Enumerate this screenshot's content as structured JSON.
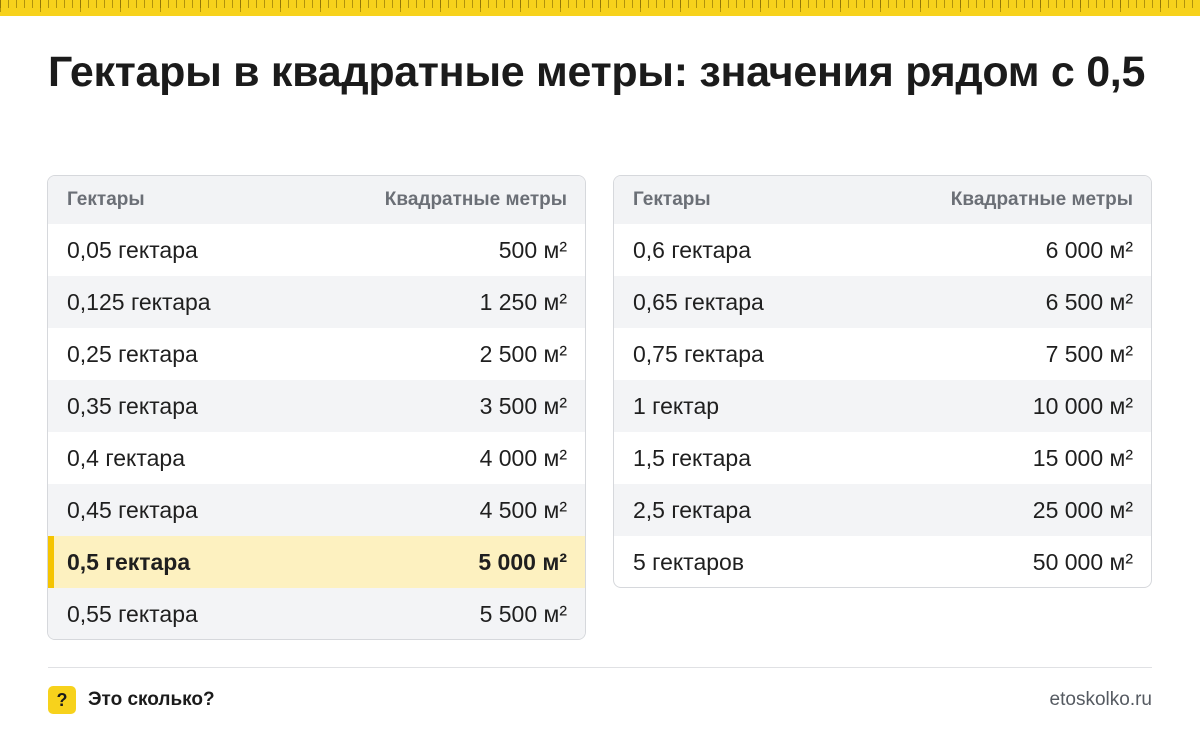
{
  "title": "Гектары в квадратные метры: значения рядом с 0,5",
  "headers": {
    "col1": "Гектары",
    "col2": "Квадратные метры"
  },
  "left_table": [
    {
      "ha": "0,05 гектара",
      "m2": "500 м²"
    },
    {
      "ha": "0,125 гектара",
      "m2": "1 250 м²"
    },
    {
      "ha": "0,25 гектара",
      "m2": "2 500 м²"
    },
    {
      "ha": "0,35 гектара",
      "m2": "3 500 м²"
    },
    {
      "ha": "0,4 гектара",
      "m2": "4 000 м²"
    },
    {
      "ha": "0,45 гектара",
      "m2": "4 500 м²"
    },
    {
      "ha": "0,5 гектара",
      "m2": "5 000 м²",
      "highlighted": true
    },
    {
      "ha": "0,55 гектара",
      "m2": "5 500 м²"
    }
  ],
  "right_table": [
    {
      "ha": "0,6 гектара",
      "m2": "6 000 м²"
    },
    {
      "ha": "0,65 гектара",
      "m2": "6 500 м²"
    },
    {
      "ha": "0,75 гектара",
      "m2": "7 500 м²"
    },
    {
      "ha": "1 гектар",
      "m2": "10 000 м²"
    },
    {
      "ha": "1,5 гектара",
      "m2": "15 000 м²"
    },
    {
      "ha": "2,5 гектара",
      "m2": "25 000 м²"
    },
    {
      "ha": "5 гектаров",
      "m2": "50 000 м²"
    }
  ],
  "footer": {
    "badge": "?",
    "brand": "Это сколько?",
    "site": "etoskolko.ru"
  },
  "colors": {
    "accent": "#f7d21c",
    "highlight_row": "#fdf1c0"
  }
}
